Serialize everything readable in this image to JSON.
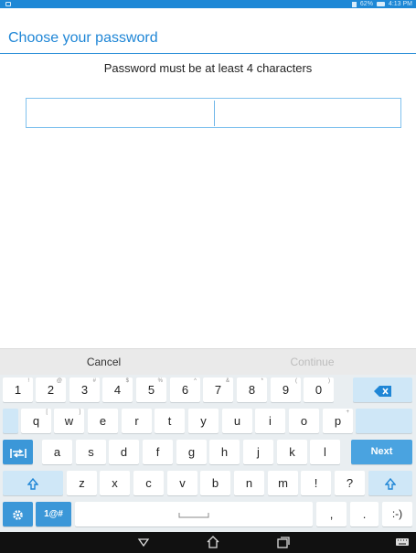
{
  "status": {
    "battery": "62%",
    "time": "4:13 PM"
  },
  "header": {
    "title": "Choose your password"
  },
  "instruction": "Password must be at least 4 characters",
  "field": {
    "value": ""
  },
  "buttons": {
    "cancel": "Cancel",
    "continue": "Continue"
  },
  "keyboard": {
    "row1": [
      {
        "k": "1",
        "h": "!"
      },
      {
        "k": "2",
        "h": "@"
      },
      {
        "k": "3",
        "h": "#"
      },
      {
        "k": "4",
        "h": "$"
      },
      {
        "k": "5",
        "h": "%"
      },
      {
        "k": "6",
        "h": "^"
      },
      {
        "k": "7",
        "h": "&"
      },
      {
        "k": "8",
        "h": "*"
      },
      {
        "k": "9",
        "h": "("
      },
      {
        "k": "0",
        "h": ")"
      }
    ],
    "row2": [
      {
        "k": "q",
        "h": "["
      },
      {
        "k": "w",
        "h": "]"
      },
      {
        "k": "e",
        "h": ""
      },
      {
        "k": "r",
        "h": ""
      },
      {
        "k": "t",
        "h": ""
      },
      {
        "k": "y",
        "h": ""
      },
      {
        "k": "u",
        "h": ""
      },
      {
        "k": "i",
        "h": ""
      },
      {
        "k": "o",
        "h": ""
      },
      {
        "k": "p",
        "h": "+"
      }
    ],
    "row3": [
      {
        "k": "a",
        "h": ""
      },
      {
        "k": "s",
        "h": ""
      },
      {
        "k": "d",
        "h": ""
      },
      {
        "k": "f",
        "h": ""
      },
      {
        "k": "g",
        "h": ""
      },
      {
        "k": "h",
        "h": ""
      },
      {
        "k": "j",
        "h": ""
      },
      {
        "k": "k",
        "h": ""
      },
      {
        "k": "l",
        "h": ""
      }
    ],
    "row4": [
      {
        "k": "z",
        "h": ""
      },
      {
        "k": "x",
        "h": ""
      },
      {
        "k": "c",
        "h": ""
      },
      {
        "k": "v",
        "h": ""
      },
      {
        "k": "b",
        "h": ""
      },
      {
        "k": "n",
        "h": ""
      },
      {
        "k": "m",
        "h": ""
      },
      {
        "k": "!",
        "h": ""
      },
      {
        "k": "?",
        "h": ""
      }
    ],
    "next_label": "Next",
    "symbols_label": "1@#",
    "comma": ",",
    "period": ".",
    "emoticon": ":-)",
    "icons": {
      "backspace": "backspace-icon",
      "tab": "tab-icon",
      "shift": "shift-icon",
      "settings": "gear-icon"
    }
  },
  "colors": {
    "accent": "#1f86d6",
    "statusbar": "#1e88d6",
    "keyboard_bg": "#e9eef1",
    "action_key": "#4aa3e0"
  },
  "nav": {
    "icons": [
      "back-icon",
      "home-icon",
      "recents-icon",
      "keyboard-icon"
    ]
  }
}
